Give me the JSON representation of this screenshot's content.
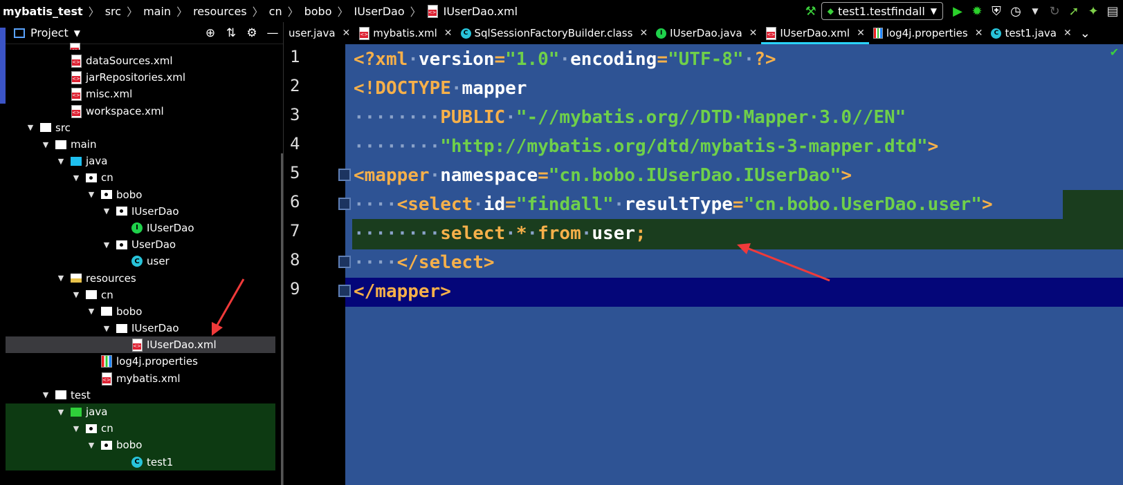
{
  "breadcrumb": {
    "project": "mybatis_test",
    "parts": [
      "src",
      "main",
      "resources",
      "cn",
      "bobo",
      "IUserDao"
    ],
    "file": "IUserDao.xml"
  },
  "toolbar": {
    "run_config": "test1.testfindall"
  },
  "project_panel": {
    "title": "Project",
    "tree": [
      {
        "label": "dataSources.xml",
        "indent": 3,
        "icon": "xml"
      },
      {
        "label": "jarRepositories.xml",
        "indent": 3,
        "icon": "xml"
      },
      {
        "label": "misc.xml",
        "indent": 3,
        "icon": "xml"
      },
      {
        "label": "workspace.xml",
        "indent": 3,
        "icon": "xml"
      },
      {
        "label": "src",
        "indent": 1,
        "icon": "folder",
        "arrow": true
      },
      {
        "label": "main",
        "indent": 2,
        "icon": "folder",
        "arrow": true
      },
      {
        "label": "java",
        "indent": 3,
        "icon": "folder-blue",
        "arrow": true
      },
      {
        "label": "cn",
        "indent": 4,
        "icon": "package",
        "arrow": true
      },
      {
        "label": "bobo",
        "indent": 5,
        "icon": "package",
        "arrow": true
      },
      {
        "label": "IUserDao",
        "indent": 6,
        "icon": "package",
        "arrow": true
      },
      {
        "label": "IUserDao",
        "indent": 7,
        "icon": "interface"
      },
      {
        "label": "UserDao",
        "indent": 6,
        "icon": "package",
        "arrow": true
      },
      {
        "label": "user",
        "indent": 7,
        "icon": "class"
      },
      {
        "label": "resources",
        "indent": 3,
        "icon": "folder-res",
        "arrow": true
      },
      {
        "label": "cn",
        "indent": 4,
        "icon": "folder",
        "arrow": true
      },
      {
        "label": "bobo",
        "indent": 5,
        "icon": "folder",
        "arrow": true
      },
      {
        "label": "IUserDao",
        "indent": 6,
        "icon": "folder",
        "arrow": true
      },
      {
        "label": "IUserDao.xml",
        "indent": 7,
        "icon": "xml",
        "selected": true
      },
      {
        "label": "log4j.properties",
        "indent": 5,
        "icon": "props"
      },
      {
        "label": "mybatis.xml",
        "indent": 5,
        "icon": "xml"
      },
      {
        "label": "test",
        "indent": 2,
        "icon": "folder",
        "arrow": true
      },
      {
        "label": "java",
        "indent": 3,
        "icon": "folder-green",
        "arrow": true,
        "test": true
      },
      {
        "label": "cn",
        "indent": 4,
        "icon": "package",
        "arrow": true,
        "test": true
      },
      {
        "label": "bobo",
        "indent": 5,
        "icon": "package",
        "arrow": true,
        "test": true
      },
      {
        "label": "test1",
        "indent": 7,
        "icon": "class",
        "test": true
      }
    ]
  },
  "tabs": [
    {
      "label": "user.java",
      "icon": "none"
    },
    {
      "label": "mybatis.xml",
      "icon": "xml"
    },
    {
      "label": "SqlSessionFactoryBuilder.class",
      "icon": "class"
    },
    {
      "label": "IUserDao.java",
      "icon": "interface"
    },
    {
      "label": "IUserDao.xml",
      "icon": "xml",
      "active": true
    },
    {
      "label": "log4j.properties",
      "icon": "props"
    },
    {
      "label": "test1.java",
      "icon": "class"
    }
  ],
  "editor": {
    "line_numbers": [
      "1",
      "2",
      "3",
      "4",
      "5",
      "6",
      "7",
      "8",
      "9"
    ],
    "lines": [
      [
        {
          "t": "<?xml",
          "c": "tag"
        },
        {
          "t": "·",
          "c": "dot"
        },
        {
          "t": "version",
          "c": "att"
        },
        {
          "t": "=",
          "c": "tag"
        },
        {
          "t": "\"1.0\"",
          "c": "str"
        },
        {
          "t": "·",
          "c": "dot"
        },
        {
          "t": "encoding",
          "c": "att"
        },
        {
          "t": "=",
          "c": "tag"
        },
        {
          "t": "\"UTF-8\"",
          "c": "str"
        },
        {
          "t": "·",
          "c": "dot"
        },
        {
          "t": "?>",
          "c": "tag"
        }
      ],
      [
        {
          "t": "<!DOCTYPE",
          "c": "tag"
        },
        {
          "t": "·",
          "c": "dot"
        },
        {
          "t": "mapper",
          "c": "att"
        }
      ],
      [
        {
          "t": "········",
          "c": "dot"
        },
        {
          "t": "PUBLIC",
          "c": "tag"
        },
        {
          "t": "·",
          "c": "dot"
        },
        {
          "t": "\"-//mybatis.org//DTD·Mapper·3.0//EN\"",
          "c": "str"
        }
      ],
      [
        {
          "t": "········",
          "c": "dot"
        },
        {
          "t": "\"http://mybatis.org/dtd/mybatis-3-mapper.dtd\"",
          "c": "str"
        },
        {
          "t": ">",
          "c": "tag"
        }
      ],
      [
        {
          "t": "<mapper",
          "c": "tag"
        },
        {
          "t": "·",
          "c": "dot"
        },
        {
          "t": "namespace",
          "c": "att"
        },
        {
          "t": "=",
          "c": "tag"
        },
        {
          "t": "\"cn.bobo.IUserDao.IUserDao\"",
          "c": "str"
        },
        {
          "t": ">",
          "c": "tag"
        }
      ],
      [
        {
          "t": "····",
          "c": "dot"
        },
        {
          "t": "<select",
          "c": "tag"
        },
        {
          "t": "·",
          "c": "dot"
        },
        {
          "t": "id",
          "c": "att"
        },
        {
          "t": "=",
          "c": "tag"
        },
        {
          "t": "\"findall\"",
          "c": "str"
        },
        {
          "t": "·",
          "c": "dot"
        },
        {
          "t": "resultType",
          "c": "att"
        },
        {
          "t": "=",
          "c": "tag"
        },
        {
          "t": "\"cn.bobo.UserDao.user\"",
          "c": "str"
        },
        {
          "t": ">",
          "c": "tag"
        }
      ],
      [
        {
          "t": "········",
          "c": "dot"
        },
        {
          "t": "select",
          "c": "kw"
        },
        {
          "t": "·",
          "c": "dot"
        },
        {
          "t": "*",
          "c": "kw"
        },
        {
          "t": "·",
          "c": "dot"
        },
        {
          "t": "from",
          "c": "kw"
        },
        {
          "t": "·",
          "c": "dot"
        },
        {
          "t": "user",
          "c": "att"
        },
        {
          "t": ";",
          "c": "kw"
        }
      ],
      [
        {
          "t": "····",
          "c": "dot"
        },
        {
          "t": "</select>",
          "c": "tag"
        }
      ],
      [
        {
          "t": "</mapper>",
          "c": "tag"
        }
      ]
    ]
  }
}
